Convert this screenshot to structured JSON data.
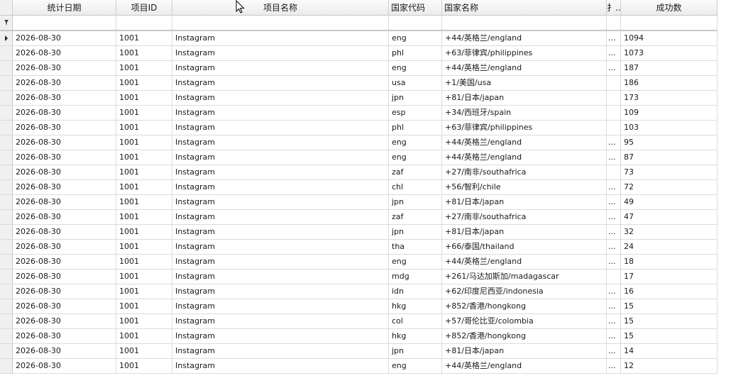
{
  "columns": [
    "统计日期",
    "项目ID",
    "项目名称",
    "国家代码",
    "国家名称",
    "扌..",
    "成功数"
  ],
  "filter_icon": "filter-pin-icon",
  "rows": [
    {
      "date": "2026-08-30",
      "project_id": "1001",
      "project_name": "Instagram",
      "country_code": "eng",
      "country_name": "+44/英格兰/england",
      "extra": "...",
      "success": "1094"
    },
    {
      "date": "2026-08-30",
      "project_id": "1001",
      "project_name": "Instagram",
      "country_code": "phl",
      "country_name": "+63/菲律宾/philippines",
      "extra": "...",
      "success": "1073"
    },
    {
      "date": "2026-08-30",
      "project_id": "1001",
      "project_name": "Instagram",
      "country_code": "eng",
      "country_name": "+44/英格兰/england",
      "extra": "...",
      "success": "187"
    },
    {
      "date": "2026-08-30",
      "project_id": "1001",
      "project_name": "Instagram",
      "country_code": "usa",
      "country_name": "+1/美国/usa",
      "extra": "",
      "success": "186"
    },
    {
      "date": "2026-08-30",
      "project_id": "1001",
      "project_name": "Instagram",
      "country_code": "jpn",
      "country_name": "+81/日本/japan",
      "extra": "",
      "success": "173"
    },
    {
      "date": "2026-08-30",
      "project_id": "1001",
      "project_name": "Instagram",
      "country_code": "esp",
      "country_name": "+34/西班牙/spain",
      "extra": "",
      "success": "109"
    },
    {
      "date": "2026-08-30",
      "project_id": "1001",
      "project_name": "Instagram",
      "country_code": "phl",
      "country_name": "+63/菲律宾/philippines",
      "extra": "",
      "success": "103"
    },
    {
      "date": "2026-08-30",
      "project_id": "1001",
      "project_name": "Instagram",
      "country_code": "eng",
      "country_name": "+44/英格兰/england",
      "extra": "...",
      "success": "95"
    },
    {
      "date": "2026-08-30",
      "project_id": "1001",
      "project_name": "Instagram",
      "country_code": "eng",
      "country_name": "+44/英格兰/england",
      "extra": "...",
      "success": "87"
    },
    {
      "date": "2026-08-30",
      "project_id": "1001",
      "project_name": "Instagram",
      "country_code": "zaf",
      "country_name": "+27/南非/southafrica",
      "extra": "",
      "success": "73"
    },
    {
      "date": "2026-08-30",
      "project_id": "1001",
      "project_name": "Instagram",
      "country_code": "chl",
      "country_name": "+56/智利/chile",
      "extra": "...",
      "success": "72"
    },
    {
      "date": "2026-08-30",
      "project_id": "1001",
      "project_name": "Instagram",
      "country_code": "jpn",
      "country_name": "+81/日本/japan",
      "extra": "...",
      "success": "49"
    },
    {
      "date": "2026-08-30",
      "project_id": "1001",
      "project_name": "Instagram",
      "country_code": "zaf",
      "country_name": "+27/南非/southafrica",
      "extra": "...",
      "success": "47"
    },
    {
      "date": "2026-08-30",
      "project_id": "1001",
      "project_name": "Instagram",
      "country_code": "jpn",
      "country_name": "+81/日本/japan",
      "extra": "...",
      "success": "32"
    },
    {
      "date": "2026-08-30",
      "project_id": "1001",
      "project_name": "Instagram",
      "country_code": "tha",
      "country_name": "+66/泰国/thailand",
      "extra": "...",
      "success": "24"
    },
    {
      "date": "2026-08-30",
      "project_id": "1001",
      "project_name": "Instagram",
      "country_code": "eng",
      "country_name": "+44/英格兰/england",
      "extra": "...",
      "success": "18"
    },
    {
      "date": "2026-08-30",
      "project_id": "1001",
      "project_name": "Instagram",
      "country_code": "mdg",
      "country_name": "+261/马达加斯加/madagascar",
      "extra": "",
      "success": "17"
    },
    {
      "date": "2026-08-30",
      "project_id": "1001",
      "project_name": "Instagram",
      "country_code": "idn",
      "country_name": "+62/印度尼西亚/indonesia",
      "extra": "...",
      "success": "16"
    },
    {
      "date": "2026-08-30",
      "project_id": "1001",
      "project_name": "Instagram",
      "country_code": "hkg",
      "country_name": "+852/香港/hongkong",
      "extra": "...",
      "success": "15"
    },
    {
      "date": "2026-08-30",
      "project_id": "1001",
      "project_name": "Instagram",
      "country_code": "col",
      "country_name": "+57/哥伦比亚/colombia",
      "extra": "...",
      "success": "15"
    },
    {
      "date": "2026-08-30",
      "project_id": "1001",
      "project_name": "Instagram",
      "country_code": "hkg",
      "country_name": "+852/香港/hongkong",
      "extra": "...",
      "success": "15"
    },
    {
      "date": "2026-08-30",
      "project_id": "1001",
      "project_name": "Instagram",
      "country_code": "jpn",
      "country_name": "+81/日本/japan",
      "extra": "...",
      "success": "14"
    },
    {
      "date": "2026-08-30",
      "project_id": "1001",
      "project_name": "Instagram",
      "country_code": "eng",
      "country_name": "+44/英格兰/england",
      "extra": "...",
      "success": "12"
    }
  ]
}
